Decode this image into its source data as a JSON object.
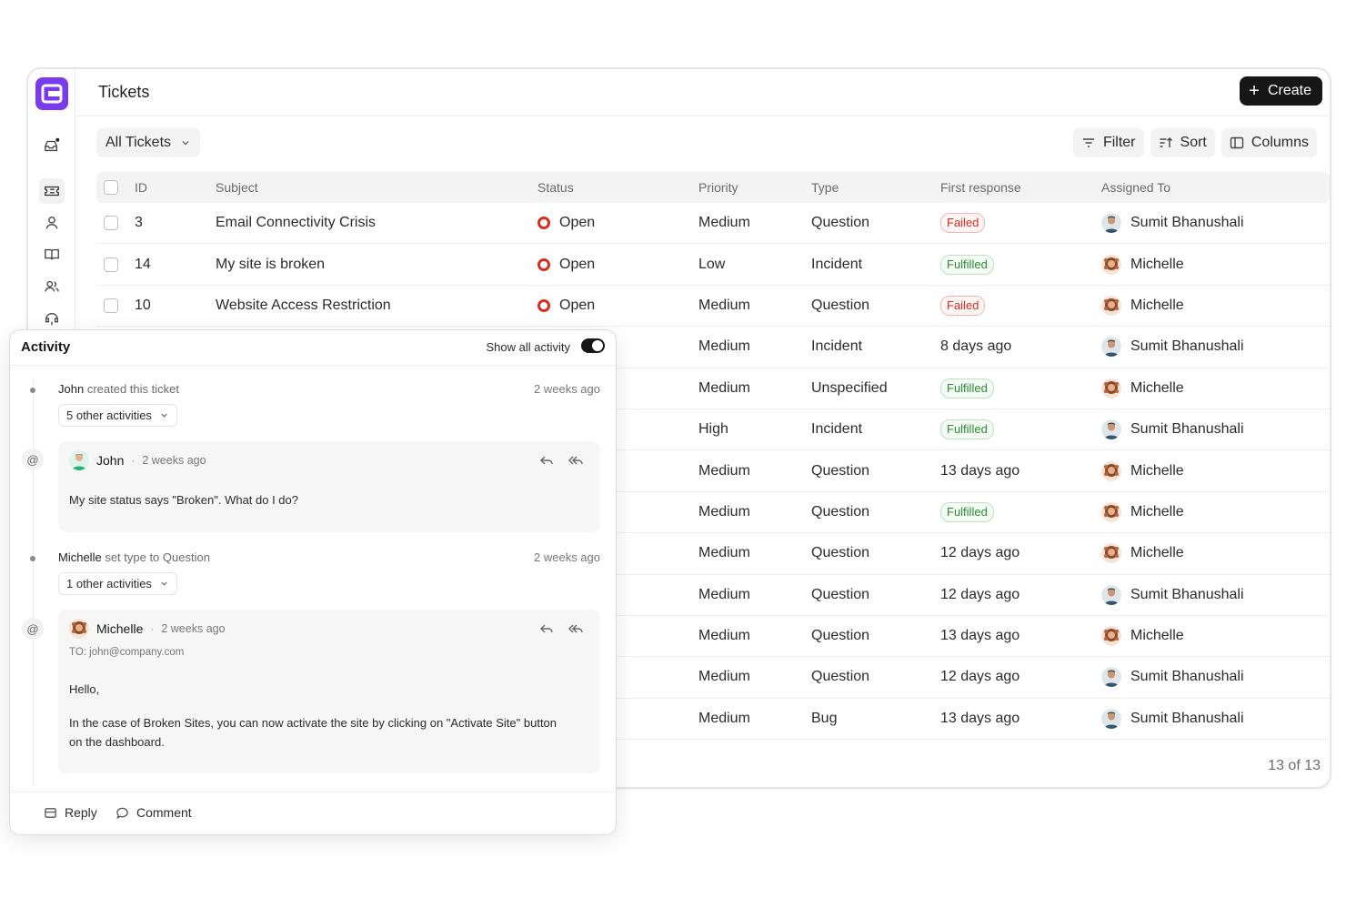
{
  "app": {
    "title": "Tickets",
    "create_label": "Create"
  },
  "toolbar": {
    "view_label": "All Tickets",
    "filter_label": "Filter",
    "sort_label": "Sort",
    "columns_label": "Columns"
  },
  "table": {
    "headers": {
      "id": "ID",
      "subject": "Subject",
      "status": "Status",
      "priority": "Priority",
      "type": "Type",
      "first_response": "First response",
      "assigned": "Assigned To"
    },
    "rows": [
      {
        "id": "3",
        "subject": "Email Connectivity Crisis",
        "status": "Open",
        "priority": "Medium",
        "type": "Question",
        "first_response": "Failed",
        "first_kind": "failed",
        "assigned": "Sumit Bhanushali",
        "avatar": "sumit"
      },
      {
        "id": "14",
        "subject": "My site is broken",
        "status": "Open",
        "priority": "Low",
        "type": "Incident",
        "first_response": "Fulfilled",
        "first_kind": "fulfilled",
        "assigned": "Michelle",
        "avatar": "michelle"
      },
      {
        "id": "10",
        "subject": "Website Access Restriction",
        "status": "Open",
        "priority": "Medium",
        "type": "Question",
        "first_response": "Failed",
        "first_kind": "failed",
        "assigned": "Michelle",
        "avatar": "michelle"
      },
      {
        "id": "",
        "subject": "",
        "status": "",
        "priority": "Medium",
        "type": "Incident",
        "first_response": "8 days ago",
        "first_kind": "text",
        "assigned": "Sumit Bhanushali",
        "avatar": "sumit"
      },
      {
        "id": "",
        "subject": "",
        "status": "",
        "priority": "Medium",
        "type": "Unspecified",
        "first_response": "Fulfilled",
        "first_kind": "fulfilled",
        "assigned": "Michelle",
        "avatar": "michelle"
      },
      {
        "id": "",
        "subject": "",
        "status": "",
        "priority": "High",
        "type": "Incident",
        "first_response": "Fulfilled",
        "first_kind": "fulfilled",
        "assigned": "Sumit Bhanushali",
        "avatar": "sumit"
      },
      {
        "id": "",
        "subject": "",
        "status": "",
        "priority": "Medium",
        "type": "Question",
        "first_response": "13 days ago",
        "first_kind": "text",
        "assigned": "Michelle",
        "avatar": "michelle"
      },
      {
        "id": "",
        "subject": "",
        "status": "",
        "priority": "Medium",
        "type": "Question",
        "first_response": "Fulfilled",
        "first_kind": "fulfilled",
        "assigned": "Michelle",
        "avatar": "michelle"
      },
      {
        "id": "",
        "subject": "",
        "status": "",
        "priority": "Medium",
        "type": "Question",
        "first_response": "12 days ago",
        "first_kind": "text",
        "assigned": "Michelle",
        "avatar": "michelle"
      },
      {
        "id": "",
        "subject": "",
        "status": "",
        "priority": "Medium",
        "type": "Question",
        "first_response": "12 days ago",
        "first_kind": "text",
        "assigned": "Sumit Bhanushali",
        "avatar": "sumit"
      },
      {
        "id": "",
        "subject": "",
        "status": "",
        "priority": "Medium",
        "type": "Question",
        "first_response": "13 days ago",
        "first_kind": "text",
        "assigned": "Michelle",
        "avatar": "michelle"
      },
      {
        "id": "",
        "subject": "",
        "status": "",
        "priority": "Medium",
        "type": "Question",
        "first_response": "12 days ago",
        "first_kind": "text",
        "assigned": "Sumit Bhanushali",
        "avatar": "sumit"
      },
      {
        "id": "",
        "subject": "",
        "status": "",
        "priority": "Medium",
        "type": "Bug",
        "first_response": "13 days ago",
        "first_kind": "text",
        "assigned": "Sumit Bhanushali",
        "avatar": "sumit"
      }
    ],
    "pager": "13 of 13"
  },
  "activity": {
    "title": "Activity",
    "toggle_label": "Show all activity",
    "events": [
      {
        "actor": "John",
        "action": "created this ticket",
        "time": "2 weeks ago",
        "more": "5 other activities"
      },
      {
        "actor": "Michelle",
        "action": "set type to Question",
        "time": "2 weeks ago",
        "more": "1 other activities"
      }
    ],
    "comment1": {
      "author": "John",
      "time": "2 weeks ago",
      "body": "My site status says \"Broken\". What do I do?"
    },
    "comment2": {
      "author": "Michelle",
      "time": "2 weeks ago",
      "to": "TO: john@company.com",
      "greeting": "Hello,",
      "body": "In the case of Broken Sites, you can now activate the site by clicking on \"Activate Site\" button on the dashboard."
    },
    "at_symbol": "@",
    "separator": "·",
    "footer": {
      "reply_label": "Reply",
      "comment_label": "Comment"
    }
  },
  "colors": {
    "brand": "#7c3aed",
    "status_open": "#d92d20",
    "failed": "#d92d20",
    "fulfilled": "#2e8b35"
  },
  "icons": [
    "inbox-icon",
    "ticket-icon",
    "user-icon",
    "book-icon",
    "users-icon",
    "support-icon",
    "filter-icon",
    "sort-icon",
    "columns-icon",
    "reply-icon",
    "reply-all-icon",
    "comment-icon"
  ]
}
